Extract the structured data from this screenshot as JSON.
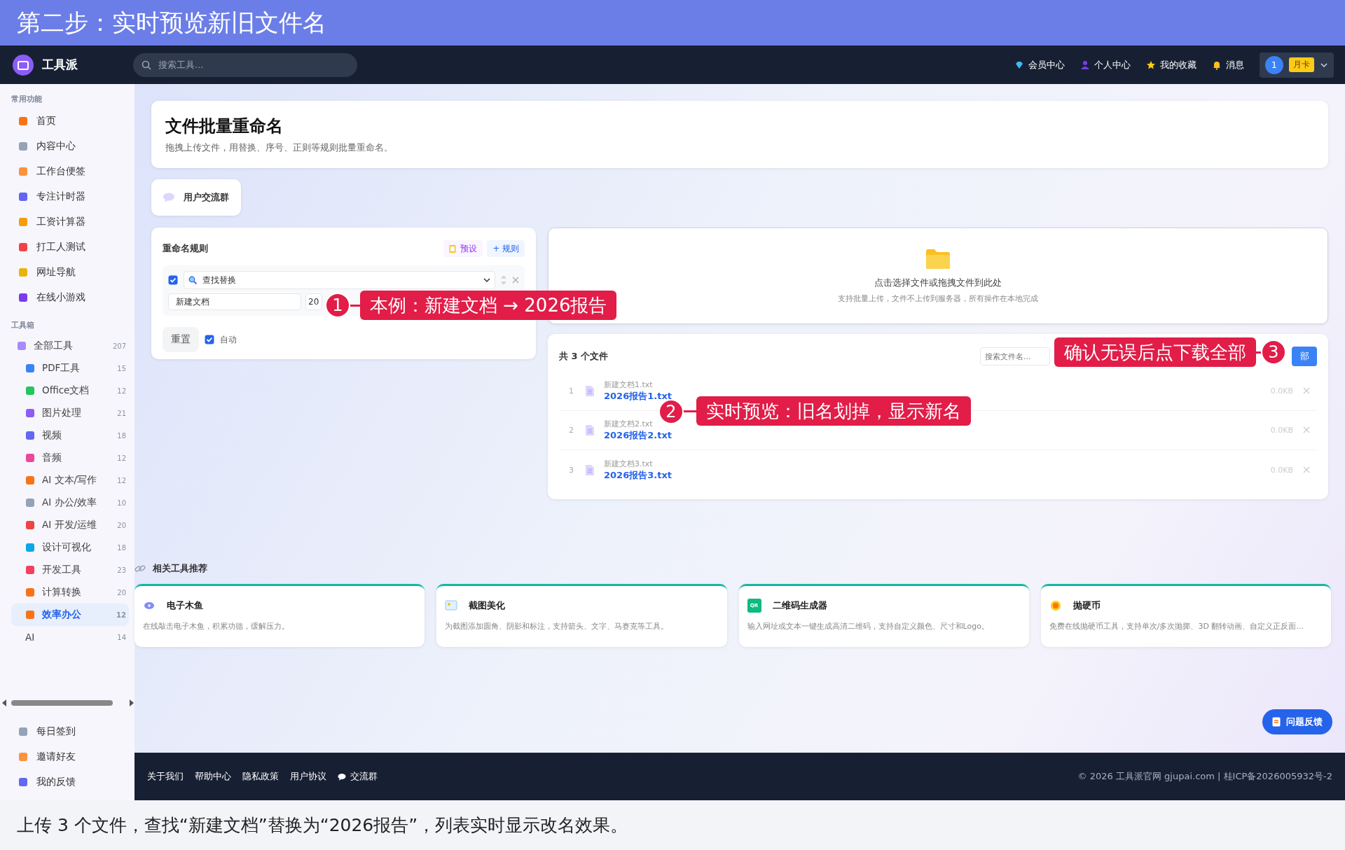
{
  "banner": {
    "title": "第二步：实时预览新旧文件名"
  },
  "navbar": {
    "brand": "工具派",
    "search": {
      "placeholder": "搜索工具..."
    },
    "links": [
      {
        "kind": "gem",
        "label": "会员中心"
      },
      {
        "kind": "person",
        "label": "个人中心"
      },
      {
        "kind": "star",
        "label": "我的收藏"
      },
      {
        "kind": "bell",
        "label": "消息"
      }
    ],
    "user": {
      "avatar": "1",
      "badge": "月卡"
    }
  },
  "sidebar": {
    "sections": [
      {
        "title": "常用功能",
        "items": [
          {
            "label": "首页",
            "selected": false
          },
          {
            "label": "内容中心",
            "selected": false
          },
          {
            "label": "工作台便签",
            "selected": false
          },
          {
            "label": "专注计时器",
            "selected": false
          },
          {
            "label": "工资计算器",
            "selected": false
          },
          {
            "label": "打工人测试",
            "selected": false
          },
          {
            "label": "网址导航",
            "selected": false
          },
          {
            "label": "在线小游戏",
            "selected": false
          }
        ]
      },
      {
        "title": "工具箱",
        "items": [
          {
            "label": "全部工具",
            "count": "207",
            "selected": false,
            "children": [
              {
                "label": "PDF工具",
                "count": "15",
                "selected": false
              },
              {
                "label": "Office文档",
                "count": "12",
                "selected": false
              },
              {
                "label": "图片处理",
                "count": "21",
                "selected": false
              },
              {
                "label": "视频",
                "count": "18",
                "selected": false
              },
              {
                "label": "音频",
                "count": "12",
                "selected": false
              },
              {
                "label": "AI 文本/写作",
                "count": "12",
                "selected": false
              },
              {
                "label": "AI 办公/效率",
                "count": "10",
                "selected": false
              },
              {
                "label": "AI 开发/运维",
                "count": "20",
                "selected": false
              },
              {
                "label": "设计可视化",
                "count": "18",
                "selected": false
              },
              {
                "label": "开发工具",
                "count": "23",
                "selected": false
              },
              {
                "label": "计算转换",
                "count": "20",
                "selected": false
              },
              {
                "label": "效率办公",
                "count": "12",
                "selected": true
              },
              {
                "label": "AI",
                "count": "14",
                "selected": false,
                "kind": "plain"
              }
            ]
          }
        ]
      }
    ],
    "bottom": [
      {
        "label": "每日签到"
      },
      {
        "label": "邀请好友"
      },
      {
        "label": "我的反馈"
      }
    ]
  },
  "header": {
    "title": "文件批量重命名",
    "subtitle": "拖拽上传文件，用替换、序号、正则等规则批量重命名。"
  },
  "group_button": {
    "label": "用户交流群"
  },
  "rules": {
    "title": "重命名规则",
    "preset": "预设",
    "add": "+ 规则",
    "rule": {
      "enabled": true,
      "type": "查找替换",
      "find": "新建文档",
      "replace": "20"
    },
    "reset": "重置",
    "auto": {
      "label": "自动",
      "checked": true
    }
  },
  "upload": {
    "title": "点击选择文件或拖拽文件到此处",
    "hint": "支持批量上传，文件不上传到服务器，所有操作在本地完成"
  },
  "files": {
    "count": "共 3 个文件",
    "search": {
      "placeholder": "搜索文件名..."
    },
    "download": "部",
    "rows": [
      {
        "index": "1",
        "old": "新建文档1.txt",
        "new": "2026报告1.txt",
        "size": "0.0KB"
      },
      {
        "index": "2",
        "old": "新建文档2.txt",
        "new": "2026报告2.txt",
        "size": "0.0KB"
      },
      {
        "index": "3",
        "old": "新建文档3.txt",
        "new": "2026报告3.txt",
        "size": "0.0KB"
      }
    ]
  },
  "related": {
    "title": "相关工具推荐",
    "cards": [
      {
        "title": "电子木鱼",
        "desc": "在线敲击电子木鱼，积累功德，缓解压力。"
      },
      {
        "title": "截图美化",
        "desc": "为截图添加圆角、阴影和标注，支持箭头、文字、马赛克等工具。"
      },
      {
        "title": "二维码生成器",
        "desc": "输入网址或文本一键生成高清二维码，支持自定义颜色、尺寸和Logo。",
        "icon_text": "QR"
      },
      {
        "title": "抛硬币",
        "desc": "免费在线抛硬币工具，支持单次/多次抛掷、3D 翻转动画、自定义正反面..."
      }
    ]
  },
  "feedback": "问题反馈",
  "footer": {
    "links": [
      "关于我们",
      "帮助中心",
      "隐私政策",
      "用户协议",
      "交流群"
    ],
    "copyright": "© 2026 工具派官网 gjupai.com | 桂ICP备2026005932号-2"
  },
  "annotations": [
    {
      "number": "1",
      "text": "本例：新建文档 → 2026报告"
    },
    {
      "number": "2",
      "text": "实时预览：旧名划掉，显示新名"
    },
    {
      "number": "3",
      "text": "确认无误后点下载全部"
    }
  ],
  "caption": "上传 3 个文件，查找“新建文档”替换为“2026报告”，列表实时显示改名效果。"
}
